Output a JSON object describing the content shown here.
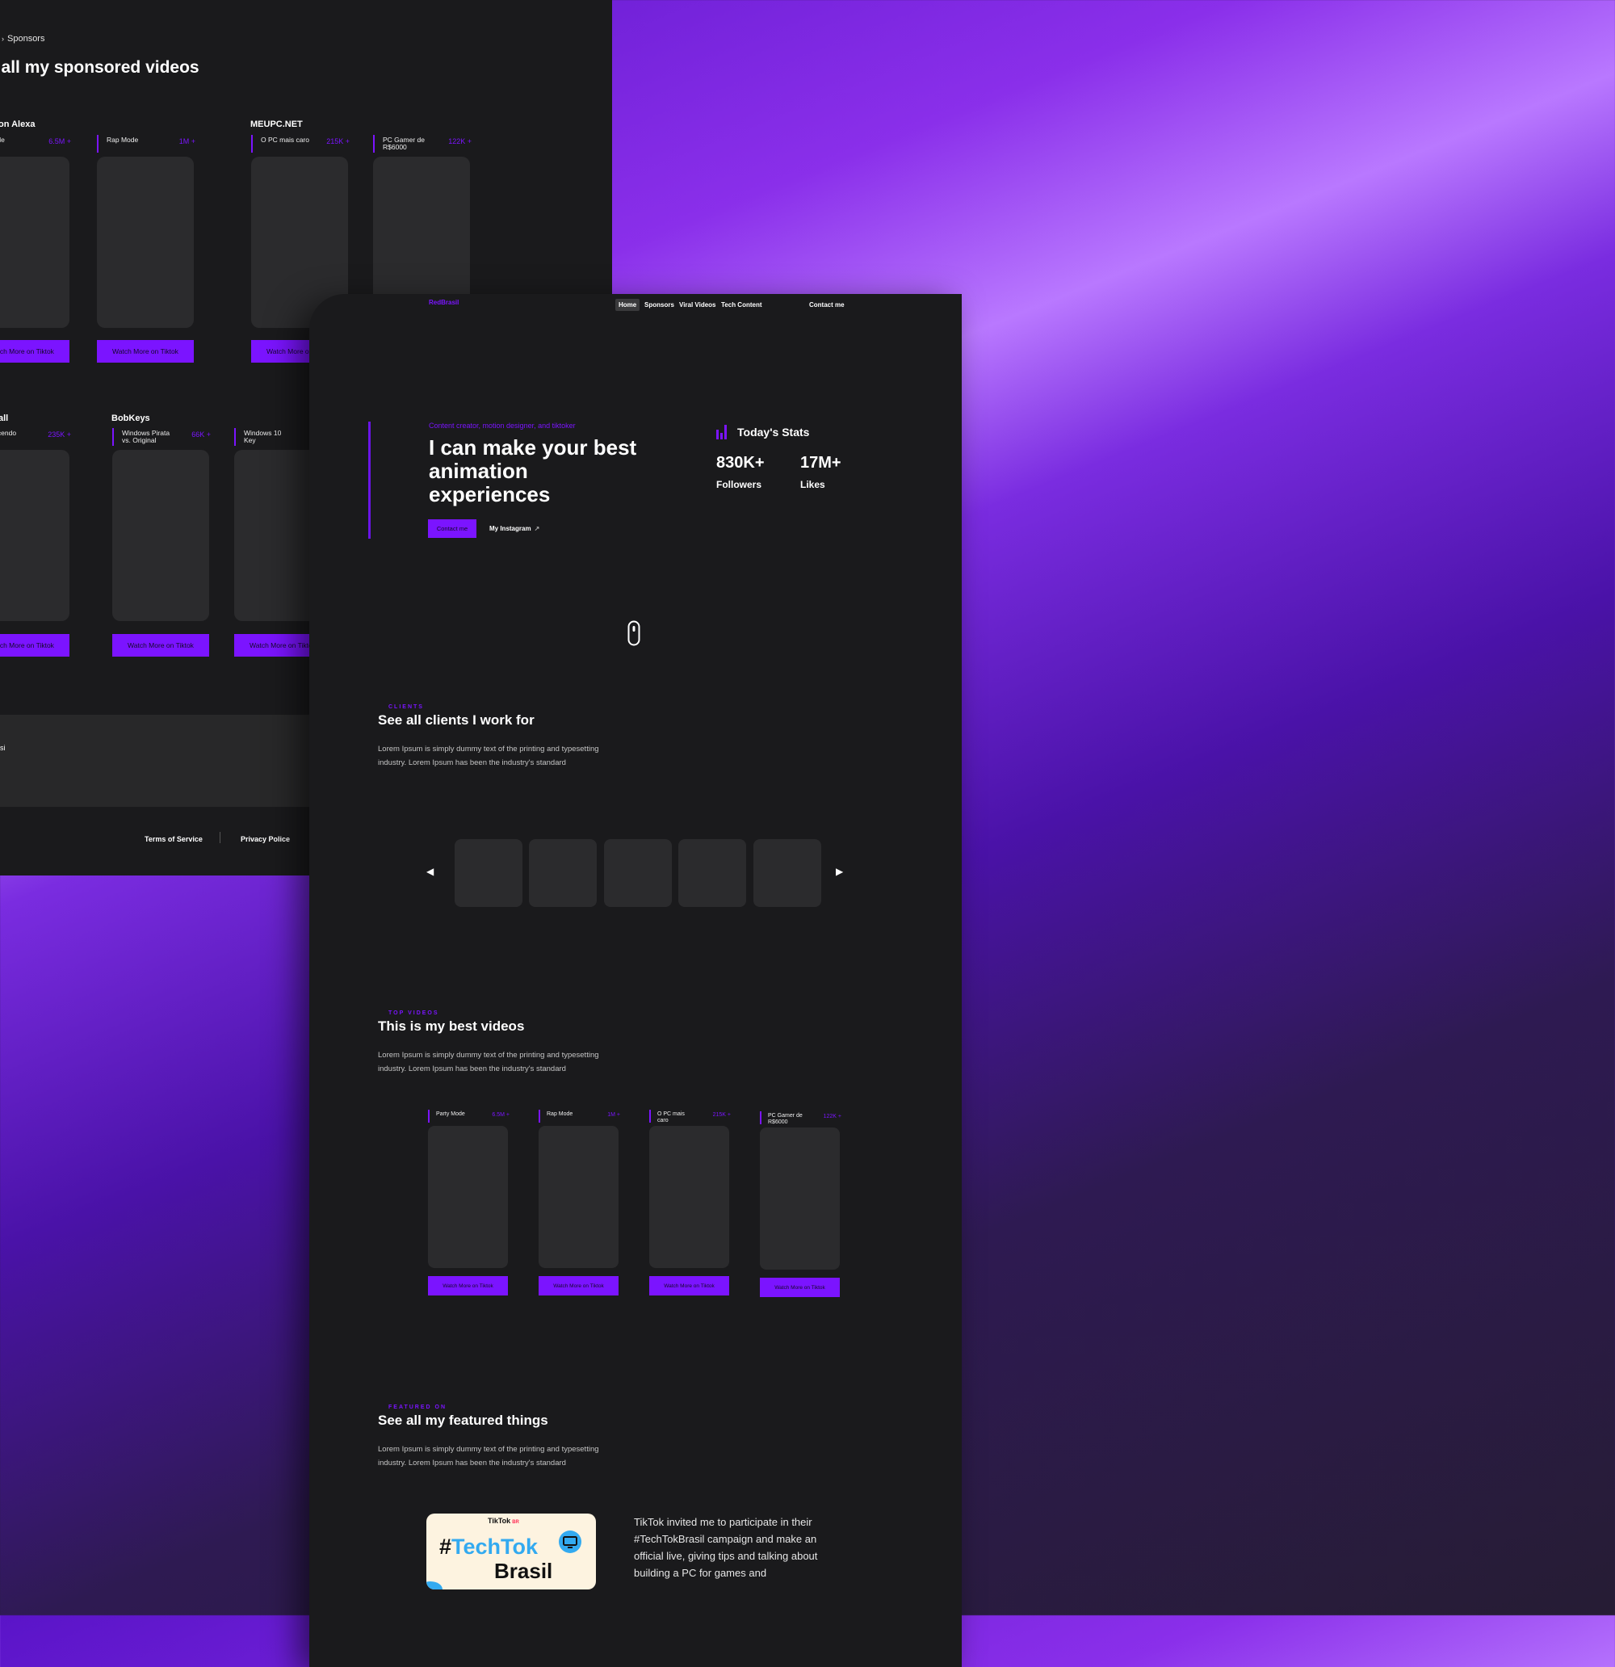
{
  "background_card": {
    "breadcrumb": "Sponsors",
    "title": "e all my sponsored videos",
    "groups": [
      {
        "label": "on Alexa"
      },
      {
        "label": "MEUPC.NET"
      },
      {
        "label": "all"
      },
      {
        "label": "BobKeys"
      }
    ],
    "videos": [
      {
        "name": "y Mode",
        "count": "6.5M +"
      },
      {
        "name": "Rap Mode",
        "count": "1M +"
      },
      {
        "name": "O PC mais caro",
        "count": "215K +"
      },
      {
        "name": "PC Gamer de R$6000",
        "count": "122K +"
      },
      {
        "name": "aquecendo ergia",
        "count": "235K +"
      },
      {
        "name": "Windows Pirata vs. Original",
        "count": "66K +"
      },
      {
        "name": "Windows 10 Key",
        "count": ""
      }
    ],
    "watch_button": "Watch More on Tiktok",
    "footer_strip": "si",
    "links": {
      "terms": "Terms of Service",
      "privacy": "Privacy Police"
    }
  },
  "nav": {
    "brand": "RedBrasil",
    "items": [
      "Home",
      "Sponsors",
      "Viral Videos",
      "Tech Content"
    ],
    "contact": "Contact me"
  },
  "hero": {
    "tagline": "Content creator, motion designer, and tiktoker",
    "title": "I can make your best animation experiences",
    "contact_button": "Contact me",
    "instagram": "My Instagram",
    "ext_icon": "↗"
  },
  "stats": {
    "title": "Today's Stats",
    "followers": {
      "value": "830K+",
      "label": "Followers"
    },
    "likes": {
      "value": "17M+",
      "label": "Likes"
    }
  },
  "clients": {
    "eyebrow": "CLIENTS",
    "title": "See all clients I work for",
    "desc": "Lorem Ipsum is simply dummy text of the printing and typesetting industry. Lorem Ipsum has been the industry's standard",
    "prev": "◀",
    "next": "▶"
  },
  "top_videos": {
    "eyebrow": "TOP VIDEOS",
    "title": "This is my best videos",
    "desc": "Lorem Ipsum is simply dummy text of the printing and typesetting industry. Lorem Ipsum has been the industry's standard",
    "videos": [
      {
        "name": "Party Mode",
        "count": "6.5M +"
      },
      {
        "name": "Rap Mode",
        "count": "1M +"
      },
      {
        "name": "O PC mais caro",
        "count": "215K +"
      },
      {
        "name": "PC Gamer de R$6000",
        "count": "122K +"
      }
    ],
    "watch_button": "Watch More on Tiktok"
  },
  "featured": {
    "eyebrow": "FEATURED ON",
    "title": "See all my featured things",
    "desc": "Lorem Ipsum is simply dummy text of the printing and typesetting industry. Lorem Ipsum has been the industry's standard",
    "logo_tiktok": "TikTok",
    "logo_mini": "BR",
    "logo_hash": "#",
    "logo_word": "TechTok",
    "logo_brasil": "Brasil",
    "text": "TikTok invited me to participate in their #TechTokBrasil campaign and make an official live, giving tips and talking about building a PC for games and"
  },
  "colors": {
    "accent": "#7b14ff",
    "card": "#1a1a1c",
    "thumb": "#2b2b2d"
  }
}
